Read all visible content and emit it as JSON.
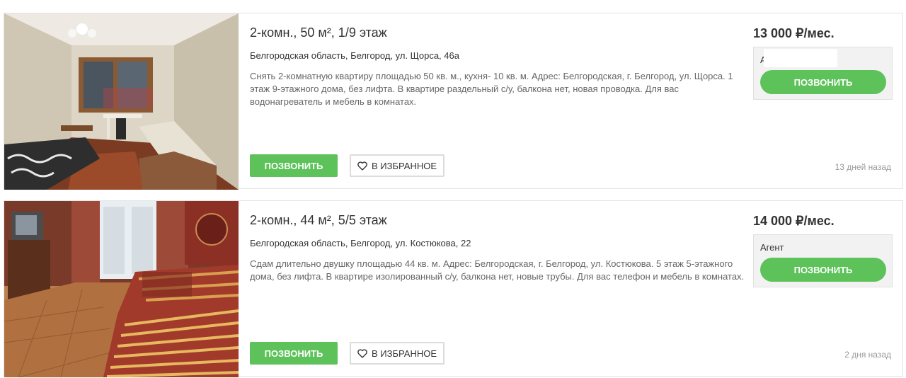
{
  "listings": [
    {
      "title": "2-комн., 50 м², 1/9 этаж",
      "address": "Белгородская область, Белгород, ул. Щорса, 46а",
      "description": "Снять 2-комнатную квартиру площадью 50 кв. м., кухня- 10 кв. м. Адрес: Белгородская, г. Белгород, ул. Щорса. 1 этаж 9-этажного дома, без лифта. В квартире раздельный с/у, балкона нет, новая проводка. Для вас водонагреватель и мебель в комнатах.",
      "price": "13 000 ₽/мес.",
      "contact": "А",
      "call_label": "ПОЗВОНИТЬ",
      "favorite_label": "В ИЗБРАННОЕ",
      "contact_call_label": "ПОЗВОНИТЬ",
      "posted": "13 дней назад",
      "photo_icon": "apartment-room-photo"
    },
    {
      "title": "2-комн., 44 м², 5/5 этаж",
      "address": "Белгородская область, Белгород, ул. Костюкова, 22",
      "description": "Сдам длительно двушку площадью 44 кв. м. Адрес: Белгородская, г. Белгород, ул. Костюкова. 5 этаж 5-этажного дома, без лифта. В квартире изолированный с/у, балкона нет, новые трубы. Для вас телефон и мебель в комнатах.",
      "price": "14 000 ₽/мес.",
      "contact": "Агент",
      "call_label": "ПОЗВОНИТЬ",
      "favorite_label": "В ИЗБРАННОЕ",
      "contact_call_label": "ПОЗВОНИТЬ",
      "posted": "2 дня назад",
      "photo_icon": "apartment-room-photo"
    }
  ],
  "colors": {
    "accent_green": "#5cc259",
    "contact_box_bg": "#f2f2f2",
    "border": "#e3e3e3",
    "muted_text": "#999999"
  }
}
